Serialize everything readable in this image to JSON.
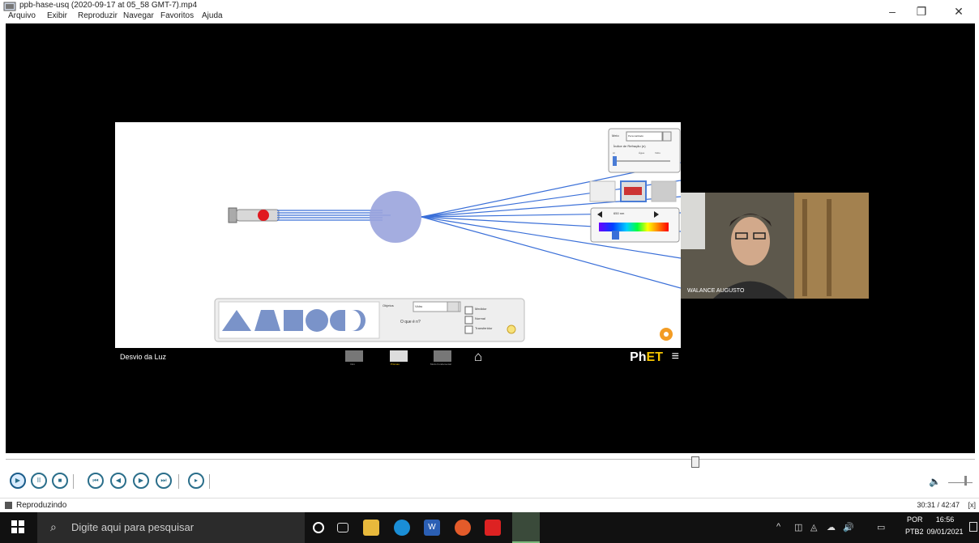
{
  "window": {
    "title": "ppb-hase-usq (2020-09-17 at 05_58 GMT-7).mp4",
    "menu": [
      "Arquivo",
      "Exibir",
      "Reproduzir",
      "Navegar",
      "Favoritos",
      "Ajuda"
    ]
  },
  "sim": {
    "title": "Desvio da Luz",
    "brand_ph": "Ph",
    "brand_et": "ET",
    "hamburger": "≡",
    "tabs": [
      "Intro",
      "Prismas",
      "Modo Fundamental"
    ],
    "shape_panel": {
      "objeto_label": "Objetos",
      "objeto_value": "Vidro",
      "what_label": "O que é n?",
      "checkboxes": [
        "Medidor",
        "Normal",
        "Transferidor"
      ]
    },
    "medium_panel": {
      "meio_label": "Meio",
      "meio_value": "Personalizado",
      "index_label": "Índice de Refração (n)",
      "scale": [
        "Ar",
        "Água",
        "Vidro"
      ]
    },
    "wavelength_value": "650 nm"
  },
  "webcam": {
    "name": "WALANCE AUGUSTO"
  },
  "player": {
    "progress": 0.716,
    "volume_icon": "🔈",
    "status": "Reproduzindo",
    "time": "30:31 / 42:47",
    "status_icon": "[x]"
  },
  "taskbar": {
    "search_placeholder": "Digite aqui para pesquisar",
    "lang_top": "POR",
    "lang_bottom": "PTB2",
    "time": "16:56",
    "date": "09/01/2021"
  },
  "colors": {
    "ray": "#3a6fd8",
    "prism_circle": "#9aa4dd",
    "shape_fill": "#7a93c9",
    "player_accent": "#2a6e8a"
  }
}
